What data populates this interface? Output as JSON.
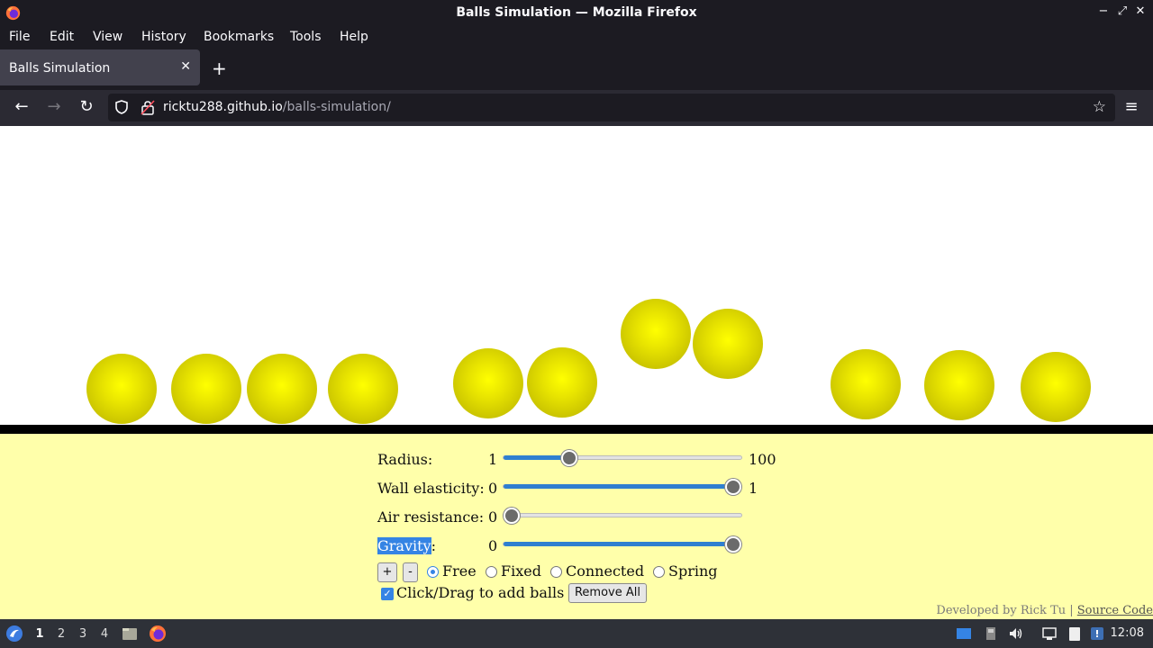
{
  "window": {
    "title": "Balls Simulation — Mozilla Firefox",
    "controls": [
      "−",
      "⤢",
      "✕"
    ]
  },
  "menu": {
    "items": [
      "File",
      "Edit",
      "View",
      "History",
      "Bookmarks",
      "Tools",
      "Help"
    ]
  },
  "tab": {
    "label": "Balls Simulation",
    "close": "✕",
    "new_tab": "+"
  },
  "nav": {
    "back": "←",
    "forward": "→",
    "reload": "↻",
    "url_host": "ricktu288.github.io",
    "url_path": "/balls-simulation/",
    "bookmark_star": "☆",
    "menu": "≡"
  },
  "simulation": {
    "ball_color": "#e6e600",
    "balls": 11
  },
  "controls": {
    "radius": {
      "label": "Radius:",
      "min": "1",
      "max": "100",
      "value": 0.26
    },
    "wall_elasticity": {
      "label": "Wall elasticity:",
      "min": "0",
      "max": "1",
      "value": 1.0
    },
    "air_resistance": {
      "label": "Air resistance:",
      "min": "0",
      "value": 0.0
    },
    "gravity": {
      "label": "Gravity",
      "colon": ":",
      "min": "0",
      "value": 1.0
    },
    "add_button": "+",
    "remove_button": "-",
    "modes": [
      "Free",
      "Fixed",
      "Connected",
      "Spring"
    ],
    "selected_mode": "Free",
    "click_drag_label": "Click/Drag to add balls",
    "click_drag_checked": true,
    "remove_all": "Remove All"
  },
  "footer": {
    "credit": "Developed by Rick Tu",
    "separator": "|",
    "source_link": "Source Code"
  },
  "taskbar": {
    "workspaces": [
      "1",
      "2",
      "3",
      "4"
    ],
    "active_workspace": "1",
    "clock": "12:08"
  }
}
